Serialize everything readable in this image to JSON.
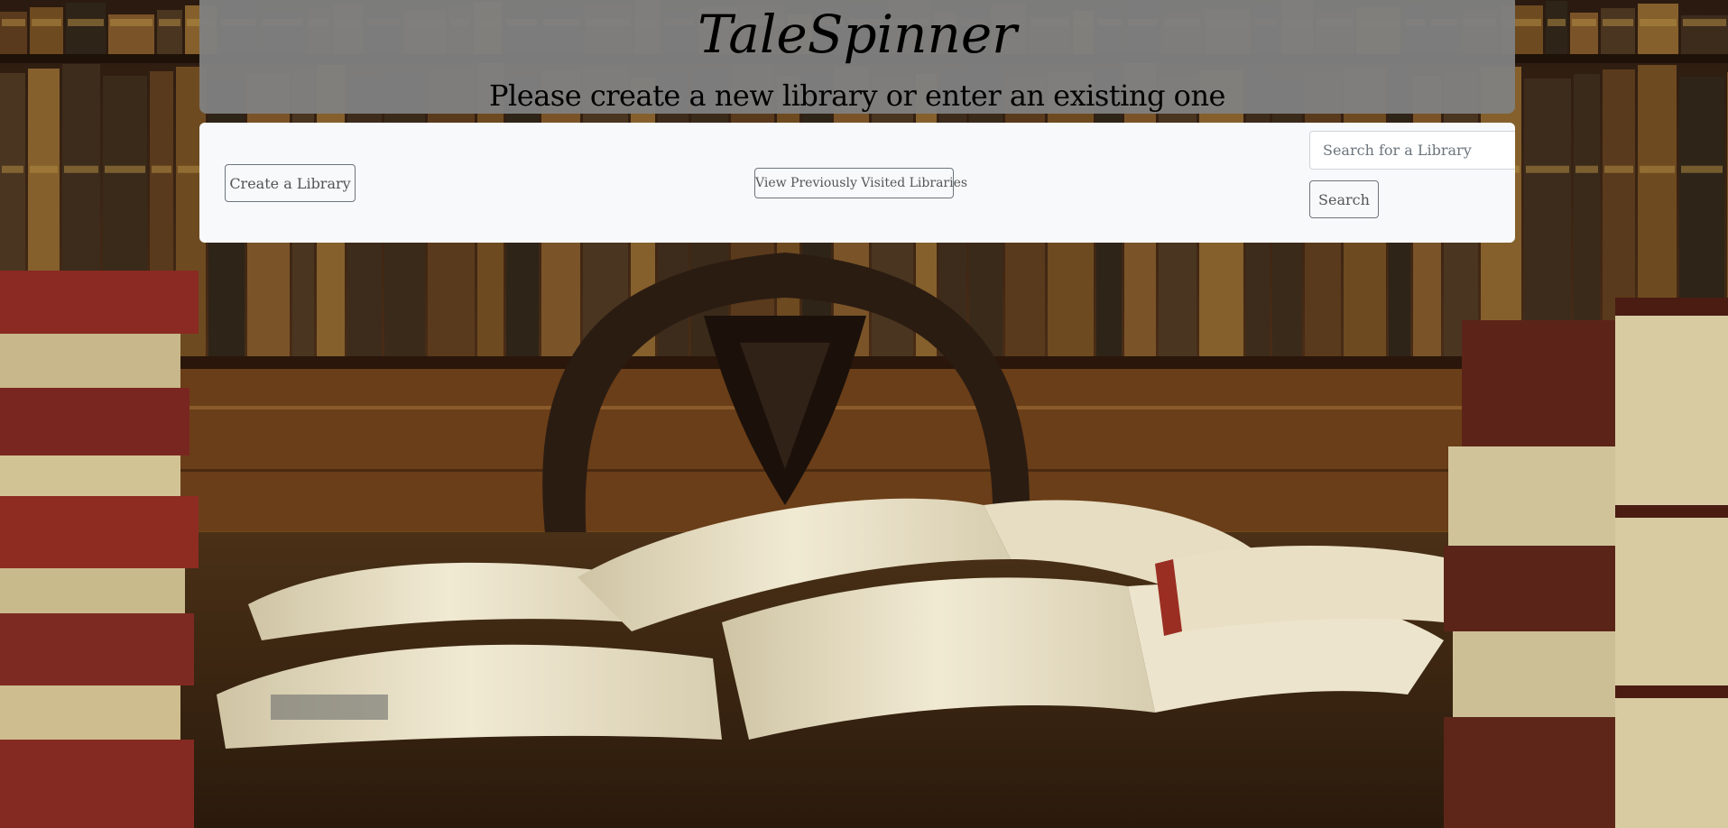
{
  "header": {
    "title": "TaleSpinner",
    "subtitle": "Please create a new library or enter an existing one"
  },
  "actions": {
    "create_label": "Create a Library",
    "history_label": "View Previously Visited Libraries",
    "search_placeholder": "Search for a Library",
    "search_value": "",
    "search_button_label": "Search"
  },
  "background": {
    "subject": "old library reading room with open books on a wooden desk, carved chair and bookshelves",
    "colors": {
      "wood_dark": "#2e1a0c",
      "wood_mid": "#6b4220",
      "book_red": "#8a2a22",
      "paper": "#e9e0c6"
    }
  }
}
